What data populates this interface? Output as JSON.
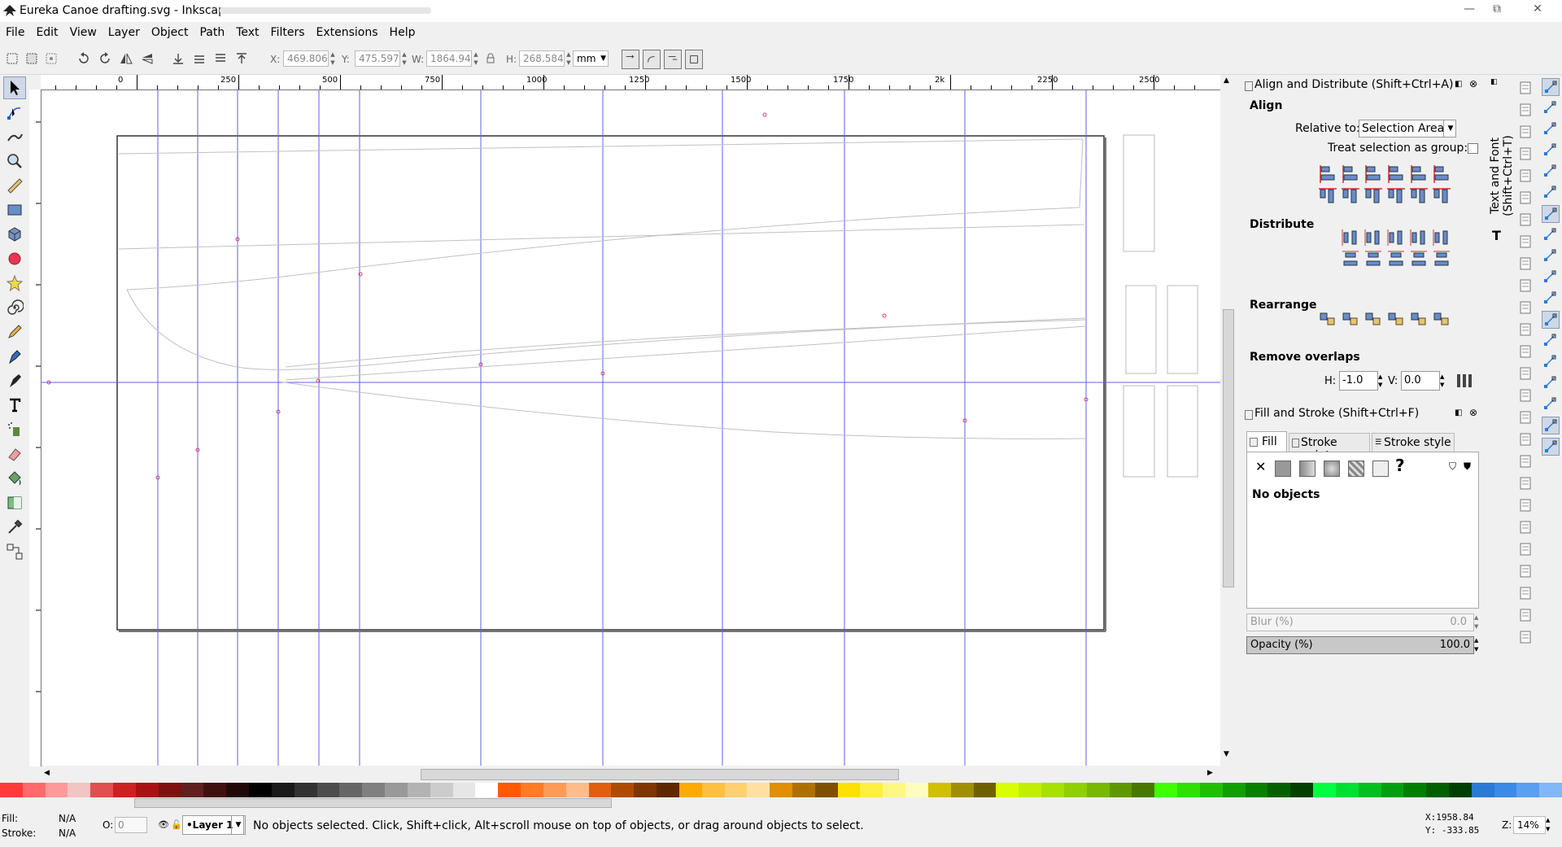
{
  "window": {
    "title": "Eureka Canoe drafting.svg - Inkscape",
    "controls": {
      "minimize": "—",
      "maximize": "⧉",
      "close": "✕"
    }
  },
  "menu": [
    "File",
    "Edit",
    "View",
    "Layer",
    "Object",
    "Path",
    "Text",
    "Filters",
    "Extensions",
    "Help"
  ],
  "toolbar": {
    "x_label": "X:",
    "x_value": "469.806",
    "y_label": "Y:",
    "y_value": "475.597",
    "w_label": "W:",
    "w_value": "1864.94",
    "h_label": "H:",
    "h_value": "268.584",
    "units": "mm"
  },
  "ruler": {
    "labels": [
      "0",
      "250",
      "500",
      "750",
      "1000",
      "1250",
      "1500",
      "1750",
      "2k",
      "2250",
      "2500"
    ]
  },
  "align_panel": {
    "title": "Align and Distribute (Shift+Ctrl+A)",
    "align_heading": "Align",
    "relative_label": "Relative to:",
    "relative_value": "Selection Area",
    "group_label": "Treat selection as group:",
    "distribute_heading": "Distribute",
    "rearrange_heading": "Rearrange",
    "overlaps_heading": "Remove overlaps",
    "h_label": "H:",
    "h_value": "-1.0",
    "v_label": "V:",
    "v_value": "0.0"
  },
  "side_tab": {
    "label": "Text and Font (Shift+Ctrl+T)"
  },
  "fill_panel": {
    "title": "Fill and Stroke (Shift+Ctrl+F)",
    "tabs": [
      "Fill",
      "Stroke paint",
      "Stroke style"
    ],
    "no_objects": "No objects",
    "blur_label": "Blur (%)",
    "blur_value": "0.0",
    "opacity_label": "Opacity (%)",
    "opacity_value": "100.0",
    "opacity_fraction": 1.0
  },
  "status": {
    "fill_label": "Fill:",
    "fill_value": "N/A",
    "stroke_label": "Stroke:",
    "stroke_value": "N/A",
    "o_label": "O:",
    "o_value": "0",
    "layer": "•Layer 1",
    "message": "No objects selected. Click, Shift+click, Alt+scroll mouse on top of objects, or drag around objects to select.",
    "cursor_x": "X:1958.84",
    "cursor_y": "Y: -333.85",
    "zoom_label": "Z:",
    "zoom_value": "14%"
  },
  "colors": {
    "guide": "#6060e8",
    "node": "#d0407a",
    "accent": "#2a7ad8"
  }
}
